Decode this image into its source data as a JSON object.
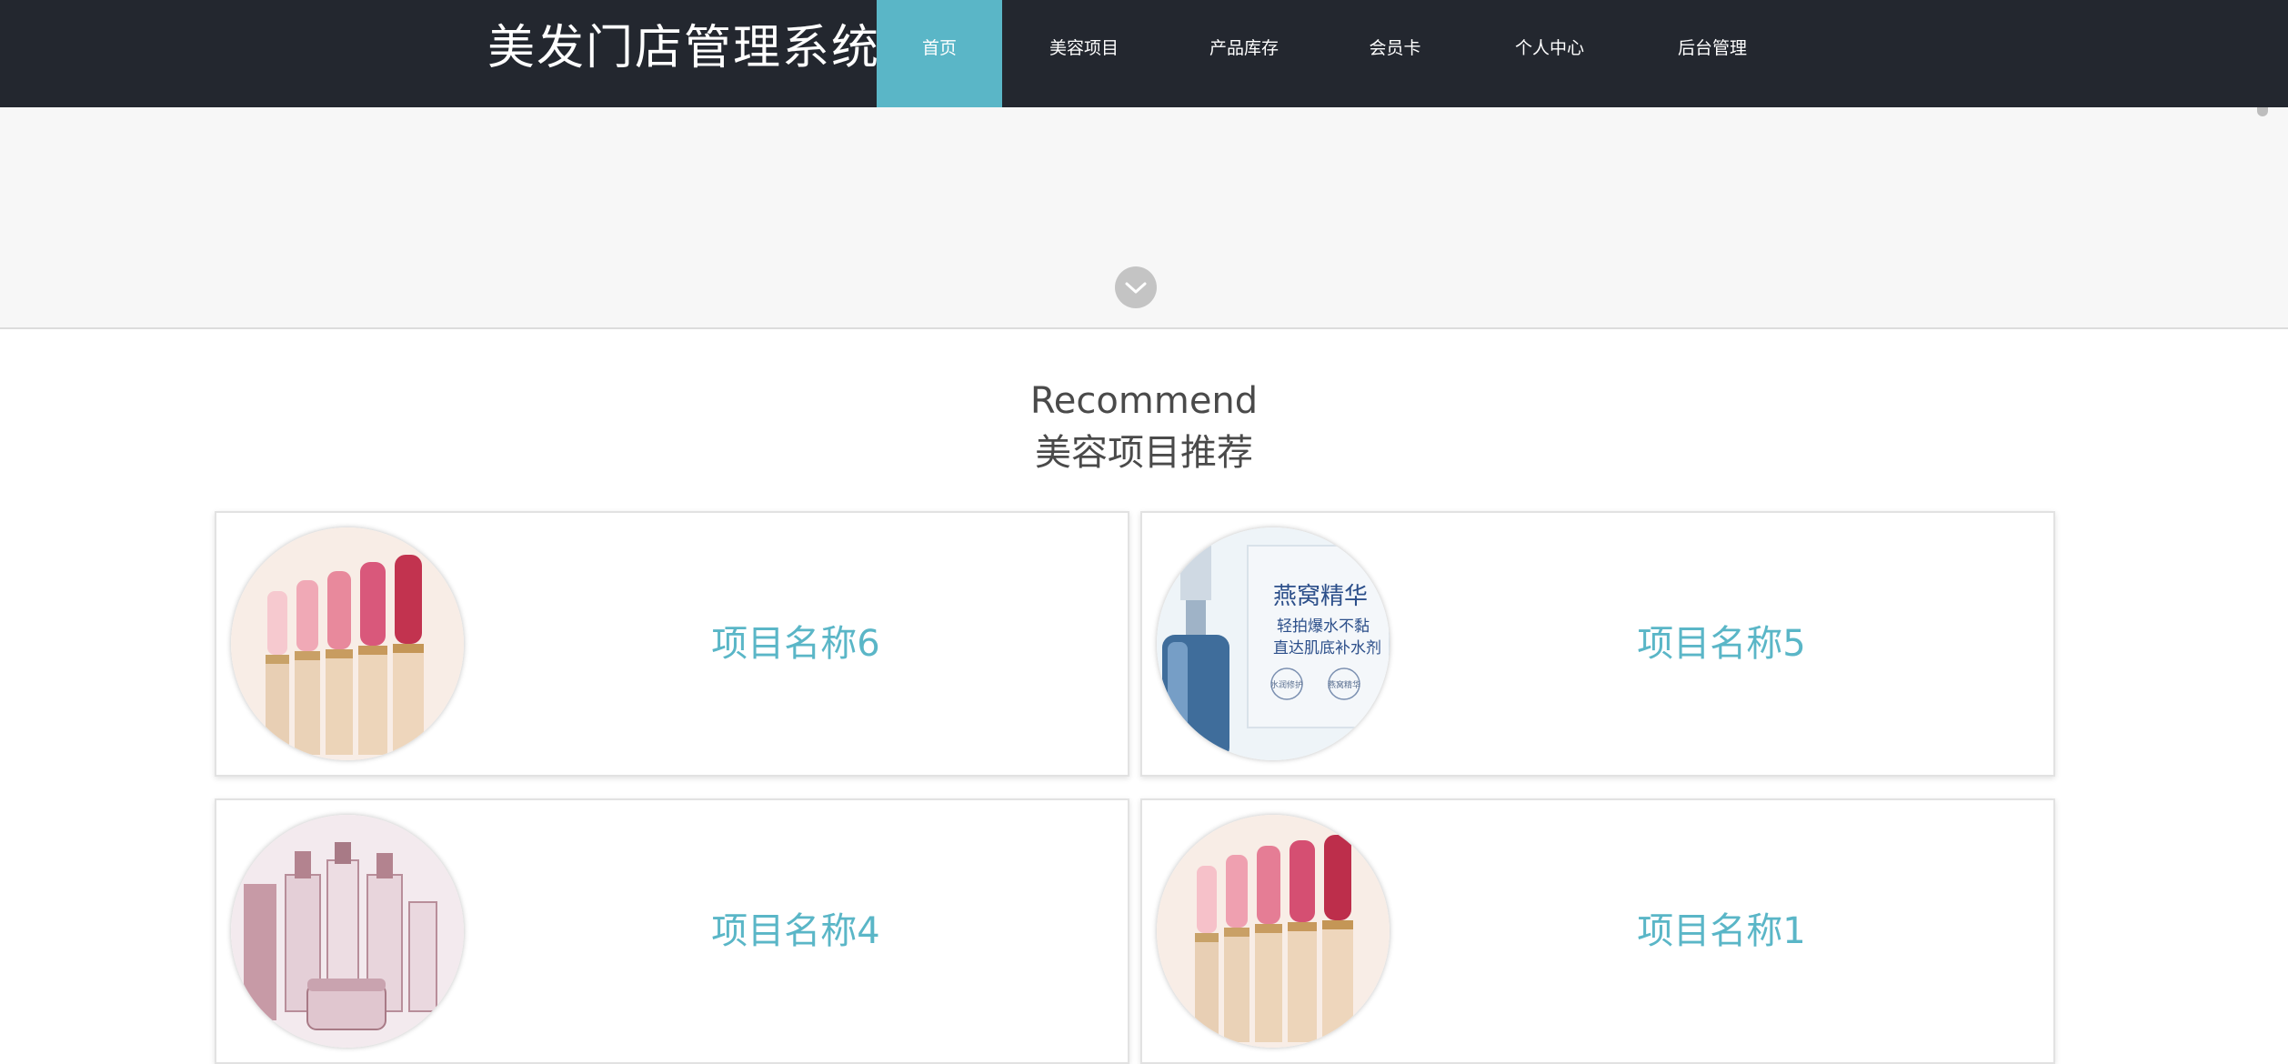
{
  "header": {
    "brand": "美发门店管理系统",
    "nav": [
      {
        "label": "首页",
        "active": true
      },
      {
        "label": "美容项目",
        "active": false
      },
      {
        "label": "产品库存",
        "active": false
      },
      {
        "label": "会员卡",
        "active": false
      },
      {
        "label": "个人中心",
        "active": false
      },
      {
        "label": "后台管理",
        "active": false
      }
    ]
  },
  "banner": {
    "scroll_icon": "chevron-down-icon"
  },
  "section": {
    "title_en": "Recommend",
    "title_cn": "美容项目推荐"
  },
  "cards": [
    {
      "name": "项目名称6",
      "image": "lipstick-set-image"
    },
    {
      "name": "项目名称5",
      "image": "serum-bottle-image",
      "image_text": [
        "燕窝精华",
        "轻拍爆水不黏",
        "直达肌底补水剂",
        "水润修护",
        "燕窝精华"
      ]
    },
    {
      "name": "项目名称4",
      "image": "skincare-set-image"
    },
    {
      "name": "项目名称1",
      "image": "lipstick-set-image"
    }
  ],
  "colors": {
    "navbar": "#23272f",
    "accent": "#5ab6c7",
    "banner": "#f7f7f7"
  }
}
